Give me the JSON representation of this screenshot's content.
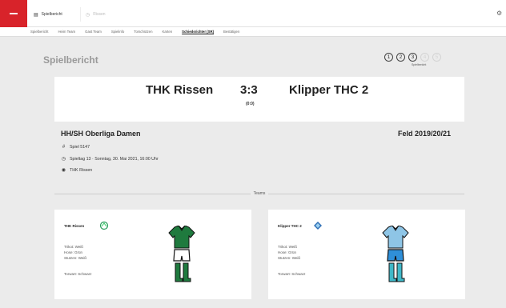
{
  "topbar": {
    "active_tab": "Spielbericht",
    "inactive_tab": "Rissen"
  },
  "subnav": {
    "items": [
      "Spielbericht",
      "Heim Team",
      "Gast Team",
      "Spielinfo",
      "Torschützen",
      "Karten",
      "Schiedsrichter (SR)",
      "Bestätigen"
    ],
    "active_index": 6
  },
  "page": {
    "title": "Spielbericht",
    "steps": [
      "1",
      "2",
      "3",
      "4",
      "5"
    ],
    "current_step": 3,
    "step_label": "Spielbericht"
  },
  "match": {
    "home": "THK Rissen",
    "score": "3:3",
    "halftime": "(0:0)",
    "away": "Klipper THC 2",
    "league": "HH/SH Oberliga Damen",
    "season": "Feld 2019/20/21",
    "game_number": "Spiel 5147",
    "date": "Spieltag 13 · Sonntag, 30. Mai 2021, 16:00 Uhr",
    "venue": "THK Rissen"
  },
  "teams_label": "Teams",
  "teams": [
    {
      "name": "THK Rissen",
      "trikot": "Trikot: Weiß",
      "hose": "Hose: Grün",
      "stutzen": "Stutzen: Weiß",
      "torwart": "Torwart: Schwarz"
    },
    {
      "name": "Klipper THC 2",
      "trikot": "Trikot: Weiß",
      "hose": "Hose: Grün",
      "stutzen": "Stutzen: Weiß",
      "torwart": "Torwart: Schwarz"
    }
  ],
  "colors": {
    "accent": "#d8232a",
    "home_shirt": "#1f7a3e",
    "home_shorts": "#ffffff",
    "home_socks": "#1f7a3e",
    "away_shirt": "#8ec5e6",
    "away_shorts": "#2f8fd8",
    "away_socks": "#3fb8c8"
  }
}
